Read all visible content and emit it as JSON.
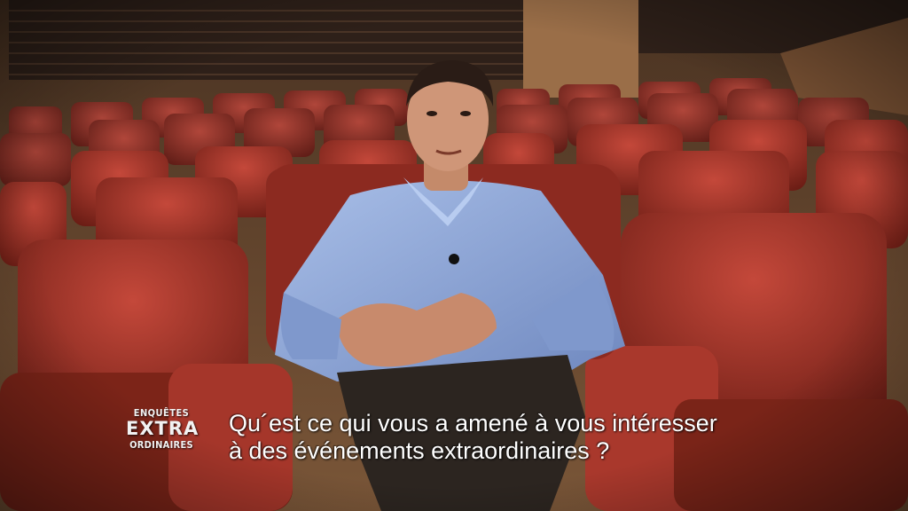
{
  "broadcast": {
    "logo": {
      "line1": "ENQUÊTES",
      "line2": "EXTRA",
      "line3": "ORDINAIRES"
    },
    "subtitle": {
      "line1": "Qu´est ce qui vous a amené à vous intéresser",
      "line2": "à des événements extraordinaires ?"
    }
  },
  "colors": {
    "seat_red": "#a8362a",
    "seat_dark": "#6e2018",
    "wall_wood": "#8a6240",
    "shirt_blue": "#8fa8d8",
    "subtitle_text": "#ffffff"
  }
}
